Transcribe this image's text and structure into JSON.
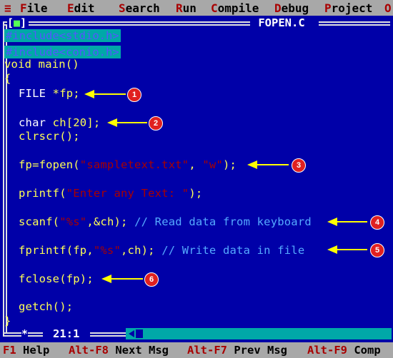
{
  "menu": {
    "system_glyph": "≡",
    "items": [
      {
        "hotkey": "F",
        "rest": "ile"
      },
      {
        "hotkey": "E",
        "rest": "dit"
      },
      {
        "hotkey": "S",
        "rest": "earch"
      },
      {
        "hotkey": "R",
        "rest": "un"
      },
      {
        "hotkey": "C",
        "rest": "ompile"
      },
      {
        "hotkey": "D",
        "rest": "ebug"
      },
      {
        "hotkey": "P",
        "rest": "roject"
      },
      {
        "hotkey": "O",
        "rest": ""
      }
    ]
  },
  "window": {
    "close_box": "[■]",
    "title": " FOPEN.C "
  },
  "code": {
    "include1": "#include<stdio.h>",
    "include2": "#include<conio.h>",
    "line_main": "void main()",
    "open_brace": "{",
    "line_file_type": "FILE ",
    "line_file_rest": "*fp;",
    "line_char_type": "char ",
    "line_char_rest": "ch[20];",
    "line_clrscr": "clrscr();",
    "line_fopen_a": "fp=fopen(",
    "line_fopen_str1": "\"sampletext.txt\"",
    "line_fopen_b": ", ",
    "line_fopen_str2": "\"w\"",
    "line_fopen_c": ");",
    "line_printf_a": "printf(",
    "line_printf_str": "\"Enter any Text: \"",
    "line_printf_b": ");",
    "line_scanf_a": "scanf(",
    "line_scanf_str": "\"%s\"",
    "line_scanf_b": ",&ch); ",
    "line_scanf_cmt": "// Read data from keyboard",
    "line_fprintf_a": "fprintf(fp,",
    "line_fprintf_str": "\"%s\"",
    "line_fprintf_b": ",ch); ",
    "line_fprintf_cmt": "// Write data in file",
    "line_fclose": "fclose(fp);",
    "line_getch": "getch();",
    "close_brace": "}"
  },
  "annotations": [
    "1",
    "2",
    "3",
    "4",
    "5",
    "6"
  ],
  "status": {
    "star": "*",
    "cursor_pos": "21:1"
  },
  "fkeys": [
    {
      "key": "F1",
      "label": " Help"
    },
    {
      "key": "Alt-F8",
      "label": " Next Msg"
    },
    {
      "key": "Alt-F7",
      "label": " Prev Msg"
    },
    {
      "key": "Alt-F9",
      "label": " Comp"
    }
  ],
  "colors": {
    "background": "#0000a8",
    "menubar": "#a8a8a8",
    "hotkey": "#a80000",
    "code_text": "#ffff55",
    "badge": "#e02020",
    "arrow": "#ffff00"
  }
}
